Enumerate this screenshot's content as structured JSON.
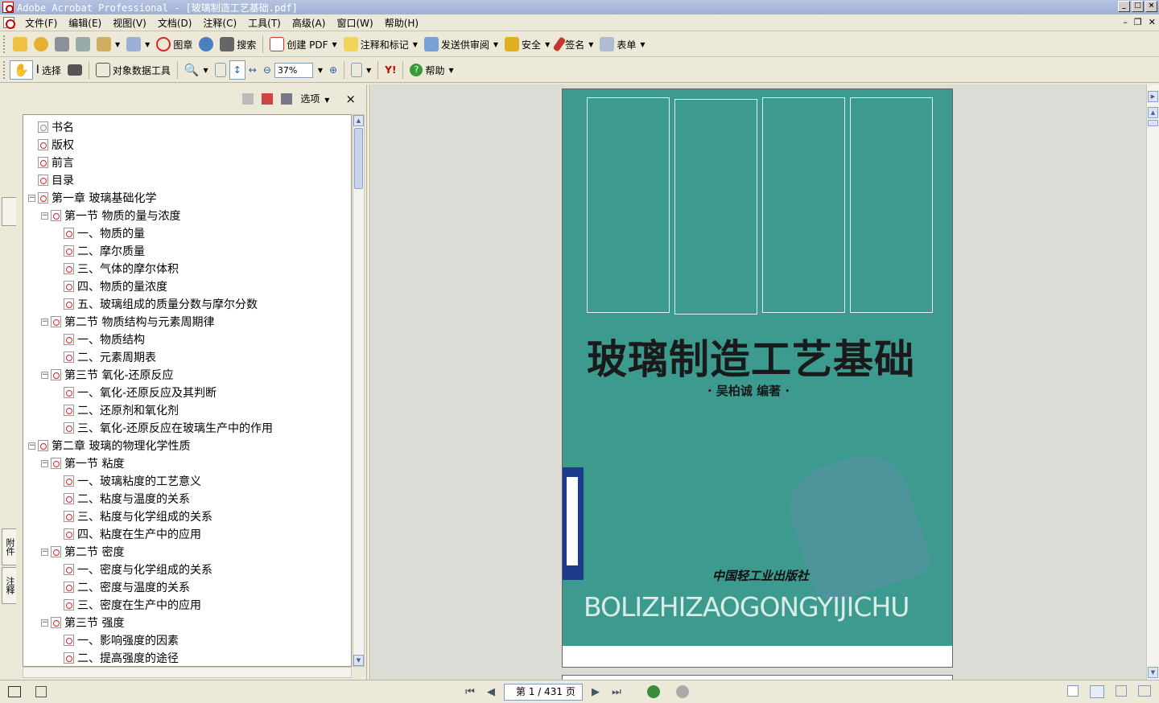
{
  "window": {
    "title": "Adobe Acrobat Professional - [玻璃制造工艺基础.pdf]"
  },
  "menu": [
    "文件(F)",
    "编辑(E)",
    "视图(V)",
    "文档(D)",
    "注释(C)",
    "工具(T)",
    "高级(A)",
    "窗口(W)",
    "帮助(H)"
  ],
  "toolbar1": {
    "stamp": "图章",
    "search": "搜索",
    "create_pdf": "创建 PDF",
    "comment": "注释和标记",
    "review": "发送供审阅",
    "security": "安全",
    "sign": "签名",
    "forms": "表单"
  },
  "toolbar2": {
    "select": "选择",
    "object_data": "对象数据工具",
    "zoom": "37%",
    "help": "帮助"
  },
  "nav": {
    "options": "选项",
    "close": "×",
    "tabs": {
      "attachments": "附件",
      "comments": "注释"
    }
  },
  "bookmarks": [
    {
      "label": "书名",
      "level": 0,
      "expander": ""
    },
    {
      "label": "版权",
      "level": 0,
      "expander": ""
    },
    {
      "label": "前言",
      "level": 0,
      "expander": ""
    },
    {
      "label": "目录",
      "level": 0,
      "expander": ""
    },
    {
      "label": "第一章  玻璃基础化学",
      "level": 0,
      "expander": "−"
    },
    {
      "label": "第一节  物质的量与浓度",
      "level": 1,
      "expander": "−"
    },
    {
      "label": "一、物质的量",
      "level": 2,
      "expander": ""
    },
    {
      "label": "二、摩尔质量",
      "level": 2,
      "expander": ""
    },
    {
      "label": "三、气体的摩尔体积",
      "level": 2,
      "expander": ""
    },
    {
      "label": "四、物质的量浓度",
      "level": 2,
      "expander": ""
    },
    {
      "label": "五、玻璃组成的质量分数与摩尔分数",
      "level": 2,
      "expander": ""
    },
    {
      "label": "第二节  物质结构与元素周期律",
      "level": 1,
      "expander": "−"
    },
    {
      "label": "一、物质结构",
      "level": 2,
      "expander": ""
    },
    {
      "label": "二、元素周期表",
      "level": 2,
      "expander": ""
    },
    {
      "label": "第三节  氧化-还原反应",
      "level": 1,
      "expander": "−"
    },
    {
      "label": "一、氧化-还原反应及其判断",
      "level": 2,
      "expander": ""
    },
    {
      "label": "二、还原剂和氧化剂",
      "level": 2,
      "expander": ""
    },
    {
      "label": "三、氧化-还原反应在玻璃生产中的作用",
      "level": 2,
      "expander": ""
    },
    {
      "label": "第二章  玻璃的物理化学性质",
      "level": 0,
      "expander": "−"
    },
    {
      "label": "第一节  粘度",
      "level": 1,
      "expander": "−"
    },
    {
      "label": "一、玻璃粘度的工艺意义",
      "level": 2,
      "expander": ""
    },
    {
      "label": "二、粘度与温度的关系",
      "level": 2,
      "expander": ""
    },
    {
      "label": "三、粘度与化学组成的关系",
      "level": 2,
      "expander": ""
    },
    {
      "label": "四、粘度在生产中的应用",
      "level": 2,
      "expander": ""
    },
    {
      "label": "第二节  密度",
      "level": 1,
      "expander": "−"
    },
    {
      "label": "一、密度与化学组成的关系",
      "level": 2,
      "expander": ""
    },
    {
      "label": "二、密度与温度的关系",
      "level": 2,
      "expander": ""
    },
    {
      "label": "三、密度在生产中的应用",
      "level": 2,
      "expander": ""
    },
    {
      "label": "第三节  强度",
      "level": 1,
      "expander": "−"
    },
    {
      "label": "一、影响强度的因素",
      "level": 2,
      "expander": ""
    },
    {
      "label": "二、提高强度的途径",
      "level": 2,
      "expander": ""
    }
  ],
  "cover": {
    "title": "玻璃制造工艺基础",
    "author": "·  吴柏诚   编著  ·",
    "publisher": "中国轻工业出版社",
    "pinyin": "BOLIZHIZAOGONGYIJICHU"
  },
  "status": {
    "page_display": "第 1 / 431 页"
  },
  "colors": {
    "cover_green": "#3c9a8e",
    "title_bar": "#9fb0d6"
  }
}
